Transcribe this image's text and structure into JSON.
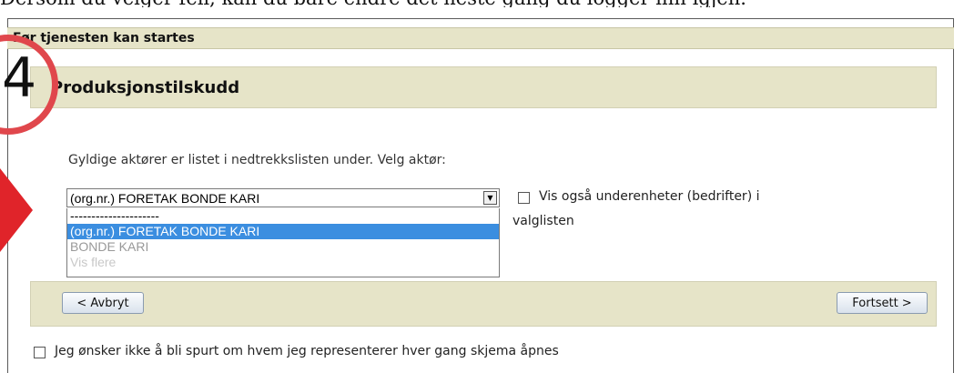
{
  "caption": "Dersom du velger feil, kan du bare endre det neste gang du logger inn igjen.",
  "header": {
    "title": "Før tjenesten kan startes"
  },
  "section": {
    "title": "Produksjonstilskudd"
  },
  "actor_select": {
    "instruction": "Gyldige aktører er listet i nedtrekkslisten under. Velg aktør:",
    "value": "(org.nr.) FORETAK BONDE KARI",
    "options": [
      "---------------------",
      "(org.nr.) FORETAK BONDE KARI",
      "BONDE KARI",
      "Vis flere"
    ]
  },
  "subunits": {
    "label_line1": "Vis også underenheter (bedrifter) i",
    "label_line2": "valglisten"
  },
  "buttons": {
    "cancel": "< Avbryt",
    "continue": "Fortsett >"
  },
  "dont_ask": {
    "label": "Jeg ønsker ikke å bli spurt om hvem jeg representerer hver gang skjema åpnes"
  },
  "overlay": {
    "step_number": "4",
    "accent_color": "#e0474c"
  }
}
